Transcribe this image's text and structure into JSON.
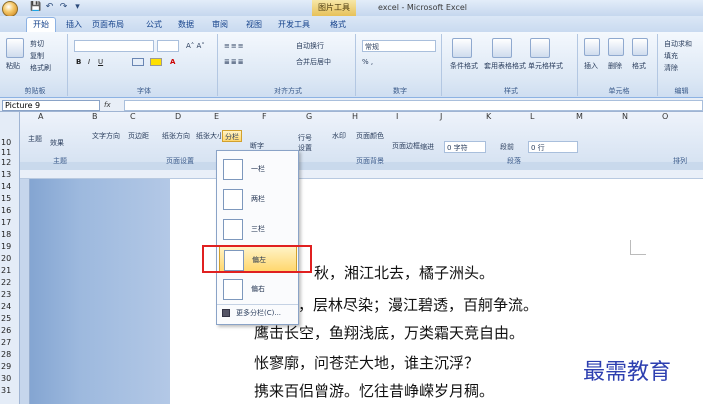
{
  "window": {
    "title": "excel - Microsoft Excel",
    "contextual_tab": "图片工具"
  },
  "tabs": [
    {
      "label": "开始",
      "active": true
    },
    {
      "label": "插入"
    },
    {
      "label": "页面布局"
    },
    {
      "label": "公式"
    },
    {
      "label": "数据"
    },
    {
      "label": "审阅"
    },
    {
      "label": "视图"
    },
    {
      "label": "开发工具"
    },
    {
      "label": "格式"
    }
  ],
  "ribbon": {
    "clipboard": {
      "paste": "粘贴",
      "cut": "剪切",
      "copy": "复制",
      "format_painter": "格式刷",
      "label": "剪贴板"
    },
    "font": {
      "label": "字体"
    },
    "alignment": {
      "wrap": "自动换行",
      "merge": "合并后居中",
      "label": "对齐方式"
    },
    "number": {
      "format": "常规",
      "label": "数字"
    },
    "styles": {
      "conditional": "条件格式",
      "table": "套用表格格式",
      "cell": "单元格样式",
      "label": "样式"
    },
    "cells": {
      "insert": "插入",
      "delete": "删除",
      "format": "格式",
      "label": "单元格"
    },
    "editing": {
      "autosum": "自动求和",
      "fill": "填充",
      "clear": "清除",
      "label": "编辑"
    }
  },
  "formula_bar": {
    "name_box": "Picture 9",
    "fx": "fx"
  },
  "columns": [
    "A",
    "B",
    "C",
    "D",
    "E",
    "F",
    "G",
    "H",
    "I",
    "J",
    "K",
    "L",
    "M",
    "N",
    "O"
  ],
  "rows": [
    "10",
    "11",
    "12",
    "13",
    "14",
    "15",
    "16",
    "17",
    "18",
    "19",
    "20",
    "21",
    "22",
    "23",
    "24",
    "25",
    "26",
    "27",
    "28",
    "29",
    "30",
    "31"
  ],
  "embedded_word_ribbon": {
    "theme_group": "主题",
    "page_setup_group": "页面设置",
    "page_bg_group": "页面背景",
    "paragraph_group": "段落",
    "theme_btn": "主题",
    "effects_btn": "效果",
    "text_direction": "文字方向",
    "margins": "页边距",
    "orientation": "纸张方向",
    "size": "纸张大小",
    "columns_btn": "分栏",
    "hyphen": "断字",
    "watermark": "水印",
    "page_color": "页面颜色",
    "border": "页面边框",
    "indent_label": "缩进",
    "indent_val": "0 字符",
    "spacing_label": "段前",
    "spacing_val": "0 行",
    "paragraph_short": "段落",
    "arrange_short": "排列",
    "settings_short": "设置",
    "line_num": "行号"
  },
  "columns_menu": {
    "items": [
      {
        "label": "一栏"
      },
      {
        "label": "两栏"
      },
      {
        "label": "三栏"
      },
      {
        "label": "偏左",
        "highlighted": true
      },
      {
        "label": "偏右"
      }
    ],
    "more": "更多分栏(C)..."
  },
  "document_lines": [
    "秋，湘江北去，橘子洲头。",
    "红遍，层林尽染；漫江碧透，百舸争流。",
    "鹰击长空，鱼翔浅底，万类霜天竞自由。",
    "怅寥廓，问苍茫大地，谁主沉浮？",
    "携来百侣曾游。忆往昔峥嵘岁月稠。"
  ],
  "watermark_text": "最需教育"
}
